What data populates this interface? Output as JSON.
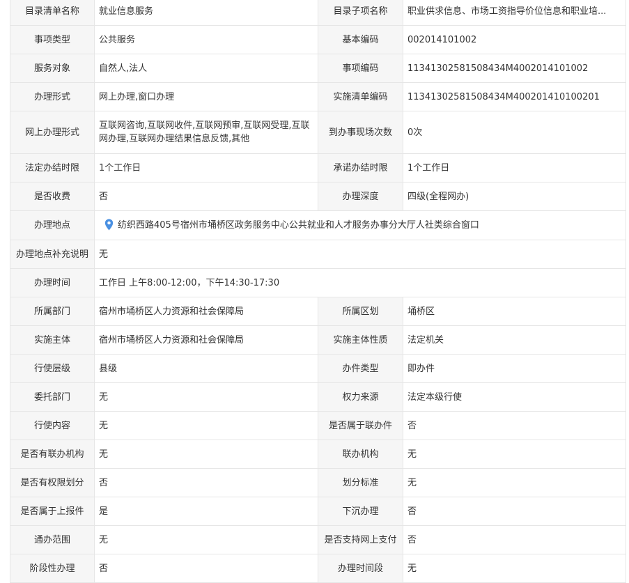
{
  "accent_color": "#4a90e2",
  "fields": {
    "catalog_name": {
      "label": "目录清单名称",
      "value": "就业信息服务"
    },
    "catalog_sub": {
      "label": "目录子项名称",
      "value": "职业供求信息、市场工资指导价位信息和职业培..."
    },
    "item_type": {
      "label": "事项类型",
      "value": "公共服务"
    },
    "basic_code": {
      "label": "基本编码",
      "value": "002014101002"
    },
    "service_target": {
      "label": "服务对象",
      "value": "自然人,法人"
    },
    "item_code": {
      "label": "事项编码",
      "value": "11341302581508434M4002014101002"
    },
    "handling_form": {
      "label": "办理形式",
      "value": "网上办理,窗口办理"
    },
    "impl_code": {
      "label": "实施清单编码",
      "value": "11341302581508434M400201410100201"
    },
    "online_form": {
      "label": "网上办理形式",
      "value": "互联网咨询,互联网收件,互联网预审,互联网受理,互联网办理,互联网办理结果信息反馈,其他"
    },
    "visits": {
      "label": "到办事现场次数",
      "value": "0次"
    },
    "legal_limit": {
      "label": "法定办结时限",
      "value": "1个工作日"
    },
    "promise_limit": {
      "label": "承诺办结时限",
      "value": "1个工作日"
    },
    "charge": {
      "label": "是否收费",
      "value": "否"
    },
    "depth": {
      "label": "办理深度",
      "value": "四级(全程网办)"
    },
    "location": {
      "label": "办理地点",
      "value": "纺织西路405号宿州市埇桥区政务服务中心公共就业和人才服务办事分大厅人社类综合窗口"
    },
    "location_note": {
      "label": "办理地点补充说明",
      "value": "无"
    },
    "hours": {
      "label": "办理时间",
      "value": "工作日 上午8:00-12:00，下午14:30-17:30"
    },
    "department": {
      "label": "所属部门",
      "value": "宿州市埇桥区人力资源和社会保障局"
    },
    "region": {
      "label": "所属区划",
      "value": "埇桥区"
    },
    "impl_body": {
      "label": "实施主体",
      "value": "宿州市埇桥区人力资源和社会保障局"
    },
    "impl_nature": {
      "label": "实施主体性质",
      "value": "法定机关"
    },
    "level": {
      "label": "行使层级",
      "value": "县级"
    },
    "case_type": {
      "label": "办件类型",
      "value": "即办件"
    },
    "entrusted": {
      "label": "委托部门",
      "value": "无"
    },
    "power_source": {
      "label": "权力来源",
      "value": "法定本级行使"
    },
    "content": {
      "label": "行使内容",
      "value": "无"
    },
    "joint_case": {
      "label": "是否属于联办件",
      "value": "否"
    },
    "joint_org_has": {
      "label": "是否有联办机构",
      "value": "无"
    },
    "joint_org": {
      "label": "联办机构",
      "value": "无"
    },
    "authority_split": {
      "label": "是否有权限划分",
      "value": "否"
    },
    "split_std": {
      "label": "划分标准",
      "value": "无"
    },
    "report_up": {
      "label": "是否属于上报件",
      "value": "是"
    },
    "sink": {
      "label": "下沉办理",
      "value": "否"
    },
    "scope": {
      "label": "通办范围",
      "value": "无"
    },
    "online_pay": {
      "label": "是否支持网上支付",
      "value": "否"
    },
    "staged": {
      "label": "阶段性办理",
      "value": "否"
    },
    "period": {
      "label": "办理时间段",
      "value": "无"
    }
  }
}
